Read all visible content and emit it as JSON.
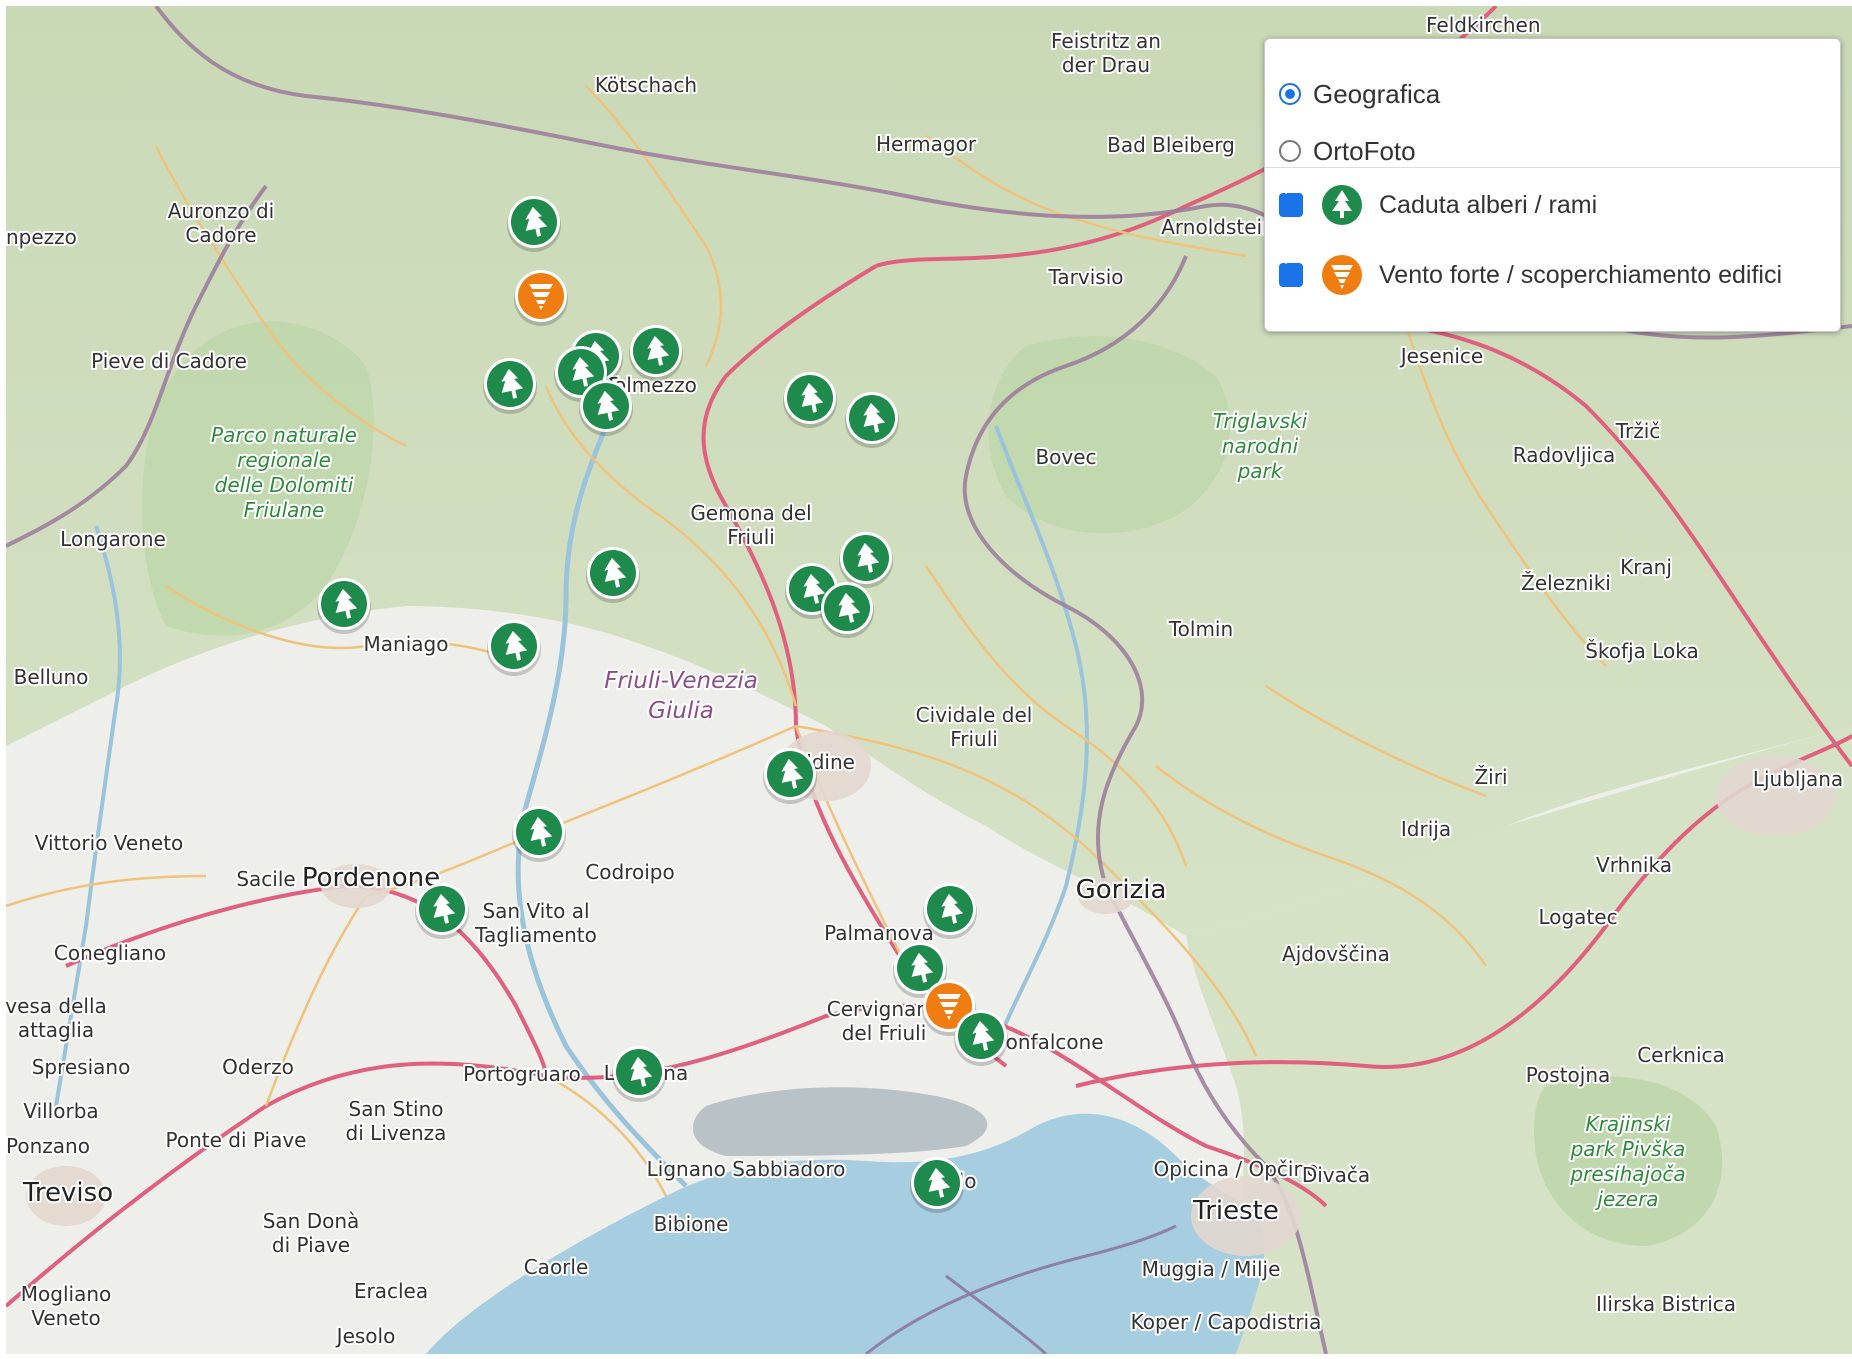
{
  "map": {
    "places": [
      {
        "name": "Feldkirchen"
      },
      {
        "name": "Feistritz an der Drau",
        "lines": [
          "Feistritz an",
          "der Drau"
        ]
      },
      {
        "name": "Kötschach"
      },
      {
        "name": "Hermagor"
      },
      {
        "name": "Bad Bleiberg"
      },
      {
        "name": "Auronzo di Cadore",
        "lines": [
          "Auronzo di",
          "Cadore"
        ]
      },
      {
        "name": "Arnoldstein"
      },
      {
        "name": "npezzo"
      },
      {
        "name": "Tarvisio"
      },
      {
        "name": "Pieve di Cadore"
      },
      {
        "name": "Tolmezzo"
      },
      {
        "name": "Jesenice"
      },
      {
        "name": "Bovec"
      },
      {
        "name": "Radovljica"
      },
      {
        "name": "Tržič"
      },
      {
        "name": "Longarone"
      },
      {
        "name": "Gemona del Friuli",
        "lines": [
          "Gemona del",
          "Friuli"
        ]
      },
      {
        "name": "Kranj"
      },
      {
        "name": "Železniki"
      },
      {
        "name": "Tolmin"
      },
      {
        "name": "Škofja Loka"
      },
      {
        "name": "Maniago"
      },
      {
        "name": "Belluno"
      },
      {
        "name": "Cividale del Friuli",
        "lines": [
          "Cividale del",
          "Friuli"
        ]
      },
      {
        "name": "Udine"
      },
      {
        "name": "Žiri"
      },
      {
        "name": "Ljubljana"
      },
      {
        "name": "Idrija"
      },
      {
        "name": "Vittorio Veneto"
      },
      {
        "name": "Vrhnika"
      },
      {
        "name": "Sacile"
      },
      {
        "name": "Pordenone"
      },
      {
        "name": "Codroipo"
      },
      {
        "name": "Gorizia"
      },
      {
        "name": "San Vito al Tagliamento",
        "lines": [
          "San Vito al",
          "Tagliamento"
        ]
      },
      {
        "name": "Palmanova"
      },
      {
        "name": "Logatec"
      },
      {
        "name": "Conegliano"
      },
      {
        "name": "Ajdovščina"
      },
      {
        "name": "vesa della attaglia",
        "lines": [
          "vesa della",
          "attaglia"
        ]
      },
      {
        "name": "Cervignano del Friuli",
        "lines": [
          "Cervignano",
          "del Friuli"
        ]
      },
      {
        "name": "Monfalcone"
      },
      {
        "name": "Cerknica"
      },
      {
        "name": "Spresiano"
      },
      {
        "name": "Oderzo"
      },
      {
        "name": "Portogruaro"
      },
      {
        "name": "Latisana"
      },
      {
        "name": "Postojna"
      },
      {
        "name": "Villorba"
      },
      {
        "name": "San Stino di Livenza",
        "lines": [
          "San Stino",
          "di Livenza"
        ]
      },
      {
        "name": "Ponzano"
      },
      {
        "name": "Ponte di Piave"
      },
      {
        "name": "Treviso"
      },
      {
        "name": "Lignano Sabbiadoro"
      },
      {
        "name": "Grado"
      },
      {
        "name": "Opicina / Opčine"
      },
      {
        "name": "Divača"
      },
      {
        "name": "Trieste"
      },
      {
        "name": "San Donà di Piave",
        "lines": [
          "San Donà",
          "di Piave"
        ]
      },
      {
        "name": "Bibione"
      },
      {
        "name": "Caorle"
      },
      {
        "name": "Mogliano Veneto",
        "lines": [
          "Mogliano",
          "Veneto"
        ]
      },
      {
        "name": "Eraclea"
      },
      {
        "name": "Muggia / Milje"
      },
      {
        "name": "Jesolo"
      },
      {
        "name": "Ilirska Bistrica"
      },
      {
        "name": "Koper / Capodistria"
      }
    ],
    "areas": [
      {
        "name": "Parco naturale regionale delle Dolomiti Friulane",
        "lines": [
          "Parco naturale",
          "regionale",
          "delle Dolomiti",
          "Friulane"
        ],
        "kind": "park"
      },
      {
        "name": "Triglavski narodni park",
        "lines": [
          "Triglavski",
          "narodni",
          "park"
        ],
        "kind": "park"
      },
      {
        "name": "Friuli-Venezia Giulia",
        "lines": [
          "Friuli-Venezia",
          "Giulia"
        ],
        "kind": "region"
      },
      {
        "name": "Krajinski park Pivška presihajoča jezera",
        "lines": [
          "Krajinski",
          "park Pivška",
          "presihajoča",
          "jezera"
        ],
        "kind": "park"
      }
    ],
    "markers": [
      {
        "type": "tree"
      },
      {
        "type": "wind"
      },
      {
        "type": "tree"
      },
      {
        "type": "tree"
      },
      {
        "type": "tree"
      },
      {
        "type": "tree"
      },
      {
        "type": "tree"
      },
      {
        "type": "tree"
      },
      {
        "type": "tree"
      },
      {
        "type": "tree"
      },
      {
        "type": "tree"
      },
      {
        "type": "tree"
      },
      {
        "type": "tree"
      },
      {
        "type": "tree"
      },
      {
        "type": "tree"
      },
      {
        "type": "tree"
      },
      {
        "type": "tree"
      },
      {
        "type": "tree"
      },
      {
        "type": "tree"
      },
      {
        "type": "tree"
      },
      {
        "type": "wind"
      },
      {
        "type": "tree"
      },
      {
        "type": "tree"
      },
      {
        "type": "tree"
      }
    ]
  },
  "layer_control": {
    "base_layers": [
      {
        "label": "Geografica",
        "selected": true
      },
      {
        "label": "OrtoFoto",
        "selected": false
      }
    ],
    "overlays": [
      {
        "label": "Caduta alberi / rami",
        "checked": true,
        "icon": "tree-icon",
        "color": "#1e8a4c"
      },
      {
        "label": "Vento forte / scoperchiamento edifici",
        "checked": true,
        "icon": "tornado-icon",
        "color": "#f07d12"
      }
    ]
  },
  "colors": {
    "tree_marker": "#1e8a4c",
    "wind_marker": "#f07d12",
    "sea": "#a6cde0",
    "border": "#9b7a9b",
    "motorway": "#e0607e",
    "accent": "#1a73e8"
  }
}
